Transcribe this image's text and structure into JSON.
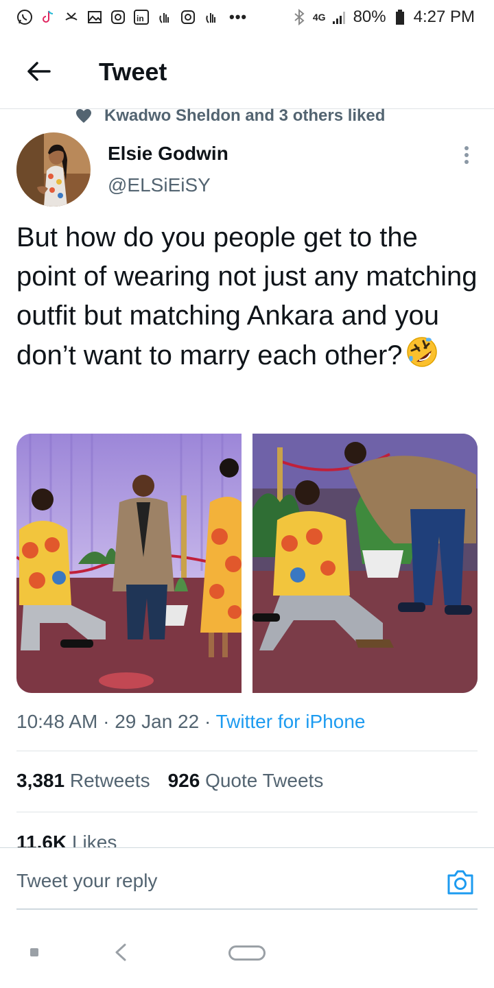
{
  "status_bar": {
    "icons": [
      "whatsapp-icon",
      "tiktok-icon",
      "missed-call-icon",
      "gallery-icon",
      "instagram-icon",
      "linkedin-icon",
      "hand-wave-icon",
      "instagram-icon",
      "hand-wave-icon"
    ],
    "more": "•••",
    "network": "4G",
    "battery": "80%",
    "time": "4:27 PM"
  },
  "header": {
    "title": "Tweet"
  },
  "social_context": {
    "text": "Kwadwo Sheldon and 3 others liked"
  },
  "author": {
    "name": "Elsie Godwin",
    "handle": "@ELSiEiSY"
  },
  "tweet": {
    "text": "But how do you people get to the point of wearing not just any matching outfit but matching Ankara and you don’t want to marry each other?",
    "emoji": "rolling-on-floor-laughing-emoji"
  },
  "meta": {
    "time": "10:48 AM",
    "sep1": " · ",
    "date": "29 Jan 22",
    "sep2": " · ",
    "source": "Twitter for iPhone"
  },
  "stats": {
    "retweets_count": "3,381",
    "retweets_label": "Retweets",
    "quotes_count": "926",
    "quotes_label": "Quote Tweets",
    "likes_count": "11.6K",
    "likes_label": "Likes"
  },
  "reply": {
    "placeholder": "Tweet your reply"
  },
  "colors": {
    "accent": "#1d9bf0",
    "secondary_text": "#536471",
    "primary_text": "#0f1419"
  }
}
